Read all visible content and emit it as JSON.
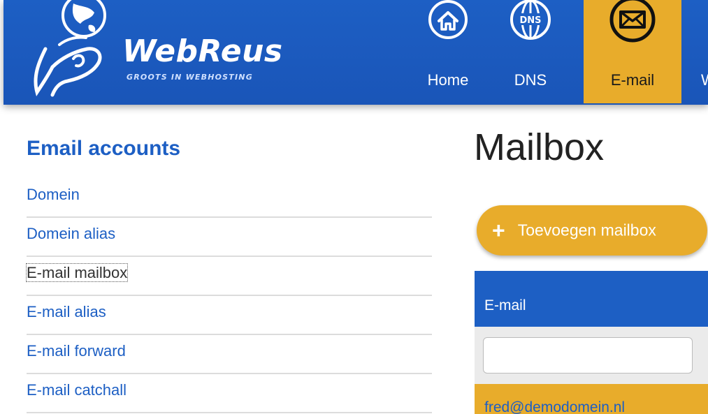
{
  "header": {
    "logo": {
      "name": "WebReus",
      "tagline": "GROOTS IN WEBHOSTING"
    },
    "nav": [
      {
        "label": "Home",
        "icon": "home-icon",
        "active": false
      },
      {
        "label": "DNS",
        "icon": "dns-globe-icon",
        "active": false
      },
      {
        "label": "E-mail",
        "icon": "envelope-icon",
        "active": true
      },
      {
        "label": "W",
        "icon": "",
        "active": false
      }
    ]
  },
  "sidebar": {
    "title": "Email accounts",
    "items": [
      {
        "label": "Domein"
      },
      {
        "label": "Domein alias"
      },
      {
        "label": "E-mail mailbox",
        "current": true
      },
      {
        "label": "E-mail alias"
      },
      {
        "label": "E-mail forward"
      },
      {
        "label": "E-mail catchall"
      }
    ]
  },
  "main": {
    "title": "Mailbox",
    "add_button": {
      "icon": "plus-icon",
      "label": "Toevoegen mailbox"
    },
    "table": {
      "columns": [
        "E-mail"
      ],
      "filter": {
        "value": "",
        "placeholder": ""
      },
      "rows": [
        {
          "email": "fred@demodomein.nl"
        }
      ]
    }
  },
  "colors": {
    "brand_blue": "#1d5fc4",
    "accent_gold": "#e8ac2b",
    "link_blue": "#1d5fc4"
  }
}
